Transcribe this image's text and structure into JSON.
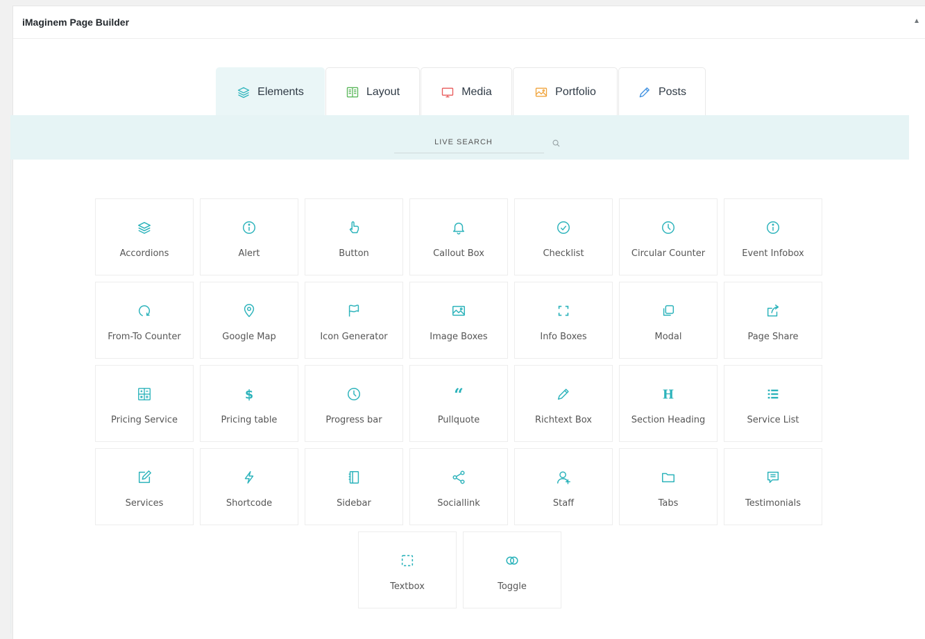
{
  "panel": {
    "title": "iMaginem Page Builder"
  },
  "tabs": [
    {
      "label": "Elements",
      "icon": "layers-icon",
      "color": "#2cb3bb"
    },
    {
      "label": "Layout",
      "icon": "book-icon",
      "color": "#5cb85c"
    },
    {
      "label": "Media",
      "icon": "monitor-icon",
      "color": "#e85a5a"
    },
    {
      "label": "Portfolio",
      "icon": "image-icon",
      "color": "#f0a43c"
    },
    {
      "label": "Posts",
      "icon": "pencil-icon",
      "color": "#3d8fe0"
    }
  ],
  "search": {
    "placeholder": "LIVE SEARCH"
  },
  "colors": {
    "accent": "#2cb3bb",
    "band": "#e6f4f5"
  },
  "elements": [
    {
      "label": "Accordions",
      "icon": "layers-icon"
    },
    {
      "label": "Alert",
      "icon": "info-icon"
    },
    {
      "label": "Button",
      "icon": "hand-pointer-icon"
    },
    {
      "label": "Callout Box",
      "icon": "bell-icon"
    },
    {
      "label": "Checklist",
      "icon": "check-circle-icon"
    },
    {
      "label": "Circular Counter",
      "icon": "clock-icon"
    },
    {
      "label": "Event Infobox",
      "icon": "info-icon"
    },
    {
      "label": "From-To Counter",
      "icon": "refresh-icon"
    },
    {
      "label": "Google Map",
      "icon": "map-pin-icon"
    },
    {
      "label": "Icon Generator",
      "icon": "flag-icon"
    },
    {
      "label": "Image Boxes",
      "icon": "image-icon"
    },
    {
      "label": "Info Boxes",
      "icon": "frame-corners-icon"
    },
    {
      "label": "Modal",
      "icon": "copy-icon"
    },
    {
      "label": "Page Share",
      "icon": "share-out-icon"
    },
    {
      "label": "Pricing Service",
      "icon": "calculator-icon"
    },
    {
      "label": "Pricing table",
      "icon": "dollar-icon"
    },
    {
      "label": "Progress bar",
      "icon": "clock-icon"
    },
    {
      "label": "Pullquote",
      "icon": "quote-icon"
    },
    {
      "label": "Richtext Box",
      "icon": "pencil-icon"
    },
    {
      "label": "Section Heading",
      "icon": "heading-icon"
    },
    {
      "label": "Service List",
      "icon": "list-icon"
    },
    {
      "label": "Services",
      "icon": "edit-icon"
    },
    {
      "label": "Shortcode",
      "icon": "bolt-icon"
    },
    {
      "label": "Sidebar",
      "icon": "notebook-icon"
    },
    {
      "label": "Sociallink",
      "icon": "share-nodes-icon"
    },
    {
      "label": "Staff",
      "icon": "user-plus-icon"
    },
    {
      "label": "Tabs",
      "icon": "folder-icon"
    },
    {
      "label": "Testimonials",
      "icon": "comment-icon"
    }
  ],
  "elements_last_row": [
    {
      "label": "Textbox",
      "icon": "dashed-square-icon"
    },
    {
      "label": "Toggle",
      "icon": "toggle-icon"
    }
  ]
}
